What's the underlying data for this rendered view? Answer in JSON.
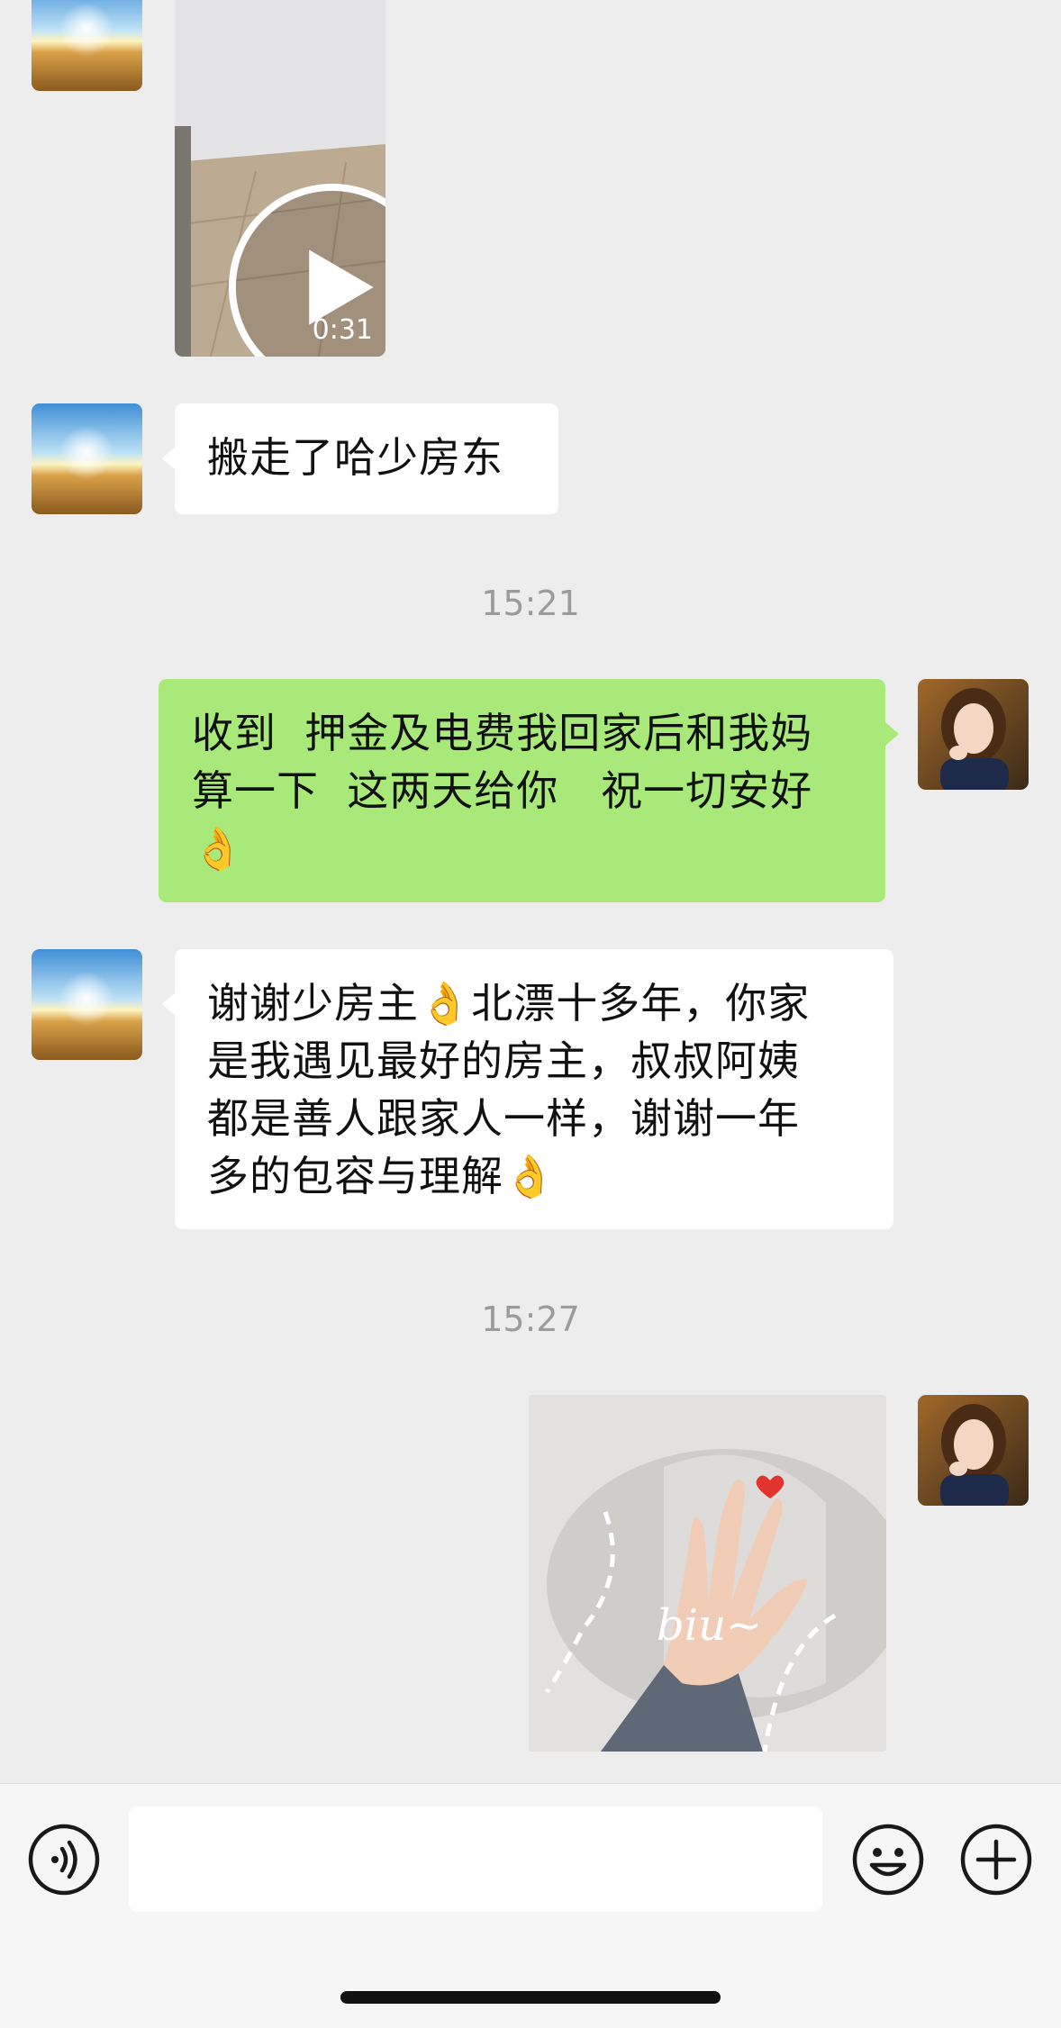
{
  "chat": {
    "video": {
      "duration": "0:31"
    },
    "messages": {
      "m1": "搬走了哈少房东",
      "m2": "收到  押金及电费我回家后和我妈\n算一下  这两天给你   祝一切安好\n👌",
      "m3": "谢谢少房主👌北漂十多年，你家\n是我遇见最好的房主，叔叔阿姨\n都是善人跟家人一样，谢谢一年\n多的包容与理解👌"
    },
    "timestamps": {
      "t1": "15:21",
      "t2": "15:27"
    },
    "sticker": {
      "caption": "biu~"
    }
  },
  "input": {
    "value": ""
  },
  "icons": {
    "voice": "voice-icon",
    "emoji": "emoji-icon",
    "add": "plus-icon",
    "play": "play-icon"
  },
  "colors": {
    "background": "#ededed",
    "bubble_sent": "#a9e97a",
    "bubble_received": "#ffffff",
    "timestamp": "#9b9b9b"
  }
}
